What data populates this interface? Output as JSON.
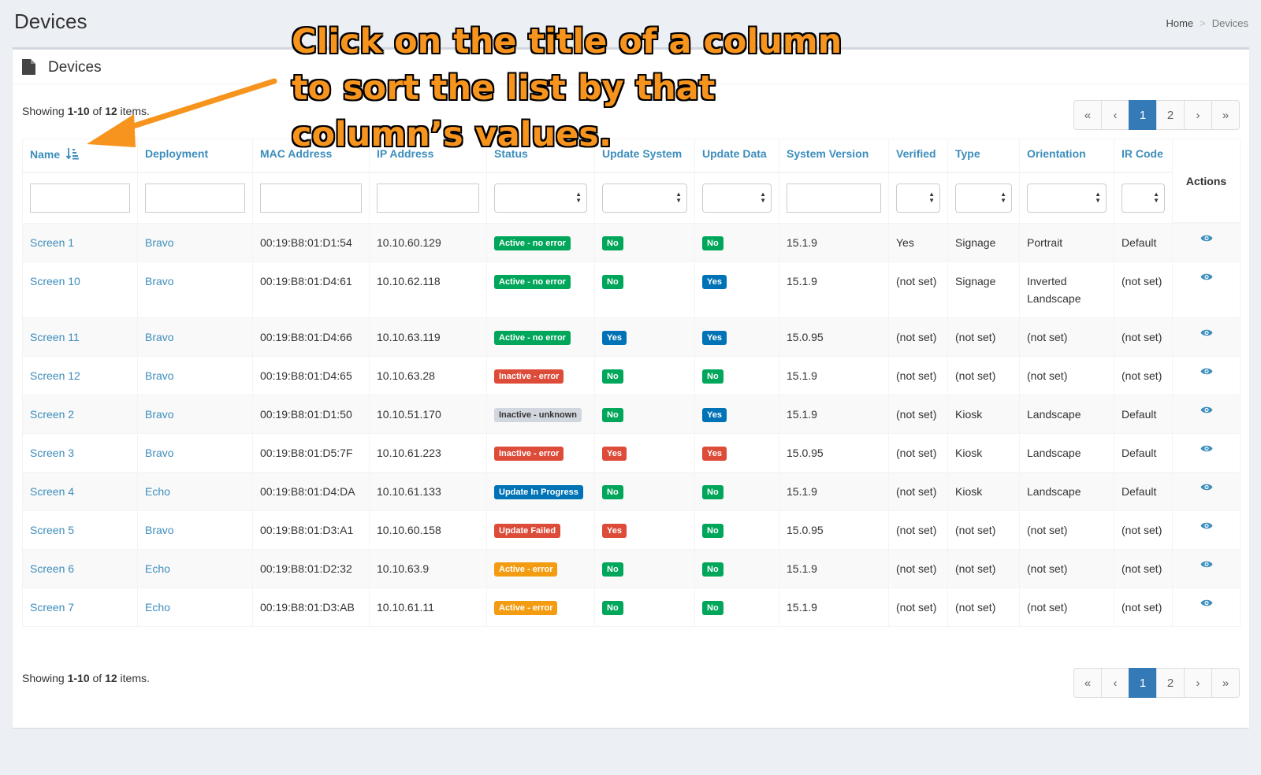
{
  "page": {
    "title": "Devices"
  },
  "breadcrumb": {
    "home": "Home",
    "current": "Devices"
  },
  "box": {
    "title": "Devices",
    "icon": "document-icon"
  },
  "summary": {
    "prefix": "Showing ",
    "range": "1-10",
    "middle": " of ",
    "total": "12",
    "suffix": " items."
  },
  "pagination": {
    "first": "«",
    "prev": "‹",
    "pages": [
      "1",
      "2"
    ],
    "active_page": "1",
    "next": "›",
    "last": "»"
  },
  "table": {
    "columns": [
      "Name",
      "Deployment",
      "MAC Address",
      "IP Address",
      "Status",
      "Update System",
      "Update Data",
      "System Version",
      "Verified",
      "Type",
      "Orientation",
      "IR Code",
      "Actions"
    ],
    "sort_icon": "sort-alpha-asc-icon",
    "rows": [
      {
        "name": "Screen 1",
        "deployment": "Bravo",
        "mac": "00:19:B8:01:D1:54",
        "ip": "10.10.60.129",
        "status": "Active - no error",
        "status_color": "green",
        "us": "No",
        "us_color": "green",
        "ud": "No",
        "ud_color": "green",
        "version": "15.1.9",
        "verified": "Yes",
        "type": "Signage",
        "orientation": "Portrait",
        "ir": "Default"
      },
      {
        "name": "Screen 10",
        "deployment": "Bravo",
        "mac": "00:19:B8:01:D4:61",
        "ip": "10.10.62.118",
        "status": "Active - no error",
        "status_color": "green",
        "us": "No",
        "us_color": "green",
        "ud": "Yes",
        "ud_color": "blue",
        "version": "15.1.9",
        "verified": "(not set)",
        "type": "Signage",
        "orientation": "Inverted Landscape",
        "ir": "(not set)"
      },
      {
        "name": "Screen 11",
        "deployment": "Bravo",
        "mac": "00:19:B8:01:D4:66",
        "ip": "10.10.63.119",
        "status": "Active - no error",
        "status_color": "green",
        "us": "Yes",
        "us_color": "blue",
        "ud": "Yes",
        "ud_color": "blue",
        "version": "15.0.95",
        "verified": "(not set)",
        "type": "(not set)",
        "orientation": "(not set)",
        "ir": "(not set)"
      },
      {
        "name": "Screen 12",
        "deployment": "Bravo",
        "mac": "00:19:B8:01:D4:65",
        "ip": "10.10.63.28",
        "status": "Inactive - error",
        "status_color": "red",
        "us": "No",
        "us_color": "green",
        "ud": "No",
        "ud_color": "green",
        "version": "15.1.9",
        "verified": "(not set)",
        "type": "(not set)",
        "orientation": "(not set)",
        "ir": "(not set)"
      },
      {
        "name": "Screen 2",
        "deployment": "Bravo",
        "mac": "00:19:B8:01:D1:50",
        "ip": "10.10.51.170",
        "status": "Inactive - unknown",
        "status_color": "grey",
        "us": "No",
        "us_color": "green",
        "ud": "Yes",
        "ud_color": "blue",
        "version": "15.1.9",
        "verified": "(not set)",
        "type": "Kiosk",
        "orientation": "Landscape",
        "ir": "Default"
      },
      {
        "name": "Screen 3",
        "deployment": "Bravo",
        "mac": "00:19:B8:01:D5:7F",
        "ip": "10.10.61.223",
        "status": "Inactive - error",
        "status_color": "red",
        "us": "Yes",
        "us_color": "red",
        "ud": "Yes",
        "ud_color": "red",
        "version": "15.0.95",
        "verified": "(not set)",
        "type": "Kiosk",
        "orientation": "Landscape",
        "ir": "Default"
      },
      {
        "name": "Screen 4",
        "deployment": "Echo",
        "mac": "00:19:B8:01:D4:DA",
        "ip": "10.10.61.133",
        "status": "Update In Progress",
        "status_color": "blue",
        "us": "No",
        "us_color": "green",
        "ud": "No",
        "ud_color": "green",
        "version": "15.1.9",
        "verified": "(not set)",
        "type": "Kiosk",
        "orientation": "Landscape",
        "ir": "Default"
      },
      {
        "name": "Screen 5",
        "deployment": "Bravo",
        "mac": "00:19:B8:01:D3:A1",
        "ip": "10.10.60.158",
        "status": "Update Failed",
        "status_color": "red",
        "us": "Yes",
        "us_color": "red",
        "ud": "No",
        "ud_color": "green",
        "version": "15.0.95",
        "verified": "(not set)",
        "type": "(not set)",
        "orientation": "(not set)",
        "ir": "(not set)"
      },
      {
        "name": "Screen 6",
        "deployment": "Echo",
        "mac": "00:19:B8:01:D2:32",
        "ip": "10.10.63.9",
        "status": "Active - error",
        "status_color": "orange",
        "us": "No",
        "us_color": "green",
        "ud": "No",
        "ud_color": "green",
        "version": "15.1.9",
        "verified": "(not set)",
        "type": "(not set)",
        "orientation": "(not set)",
        "ir": "(not set)"
      },
      {
        "name": "Screen 7",
        "deployment": "Echo",
        "mac": "00:19:B8:01:D3:AB",
        "ip": "10.10.61.11",
        "status": "Active - error",
        "status_color": "orange",
        "us": "No",
        "us_color": "green",
        "ud": "No",
        "ud_color": "green",
        "version": "15.1.9",
        "verified": "(not set)",
        "type": "(not set)",
        "orientation": "(not set)",
        "ir": "(not set)"
      }
    ],
    "row_action_icon": "eye-icon"
  },
  "annotation": {
    "text": "Click on the title of a column\nto sort the list by that\ncolumn’s values.",
    "color": "#f7941d"
  },
  "colors": {
    "link": "#3c8dbc",
    "primary": "#337ab7",
    "green": "#00a65a",
    "red": "#dd4b39",
    "blue": "#0073b7",
    "orange": "#f39c12",
    "grey": "#d2d6de"
  }
}
